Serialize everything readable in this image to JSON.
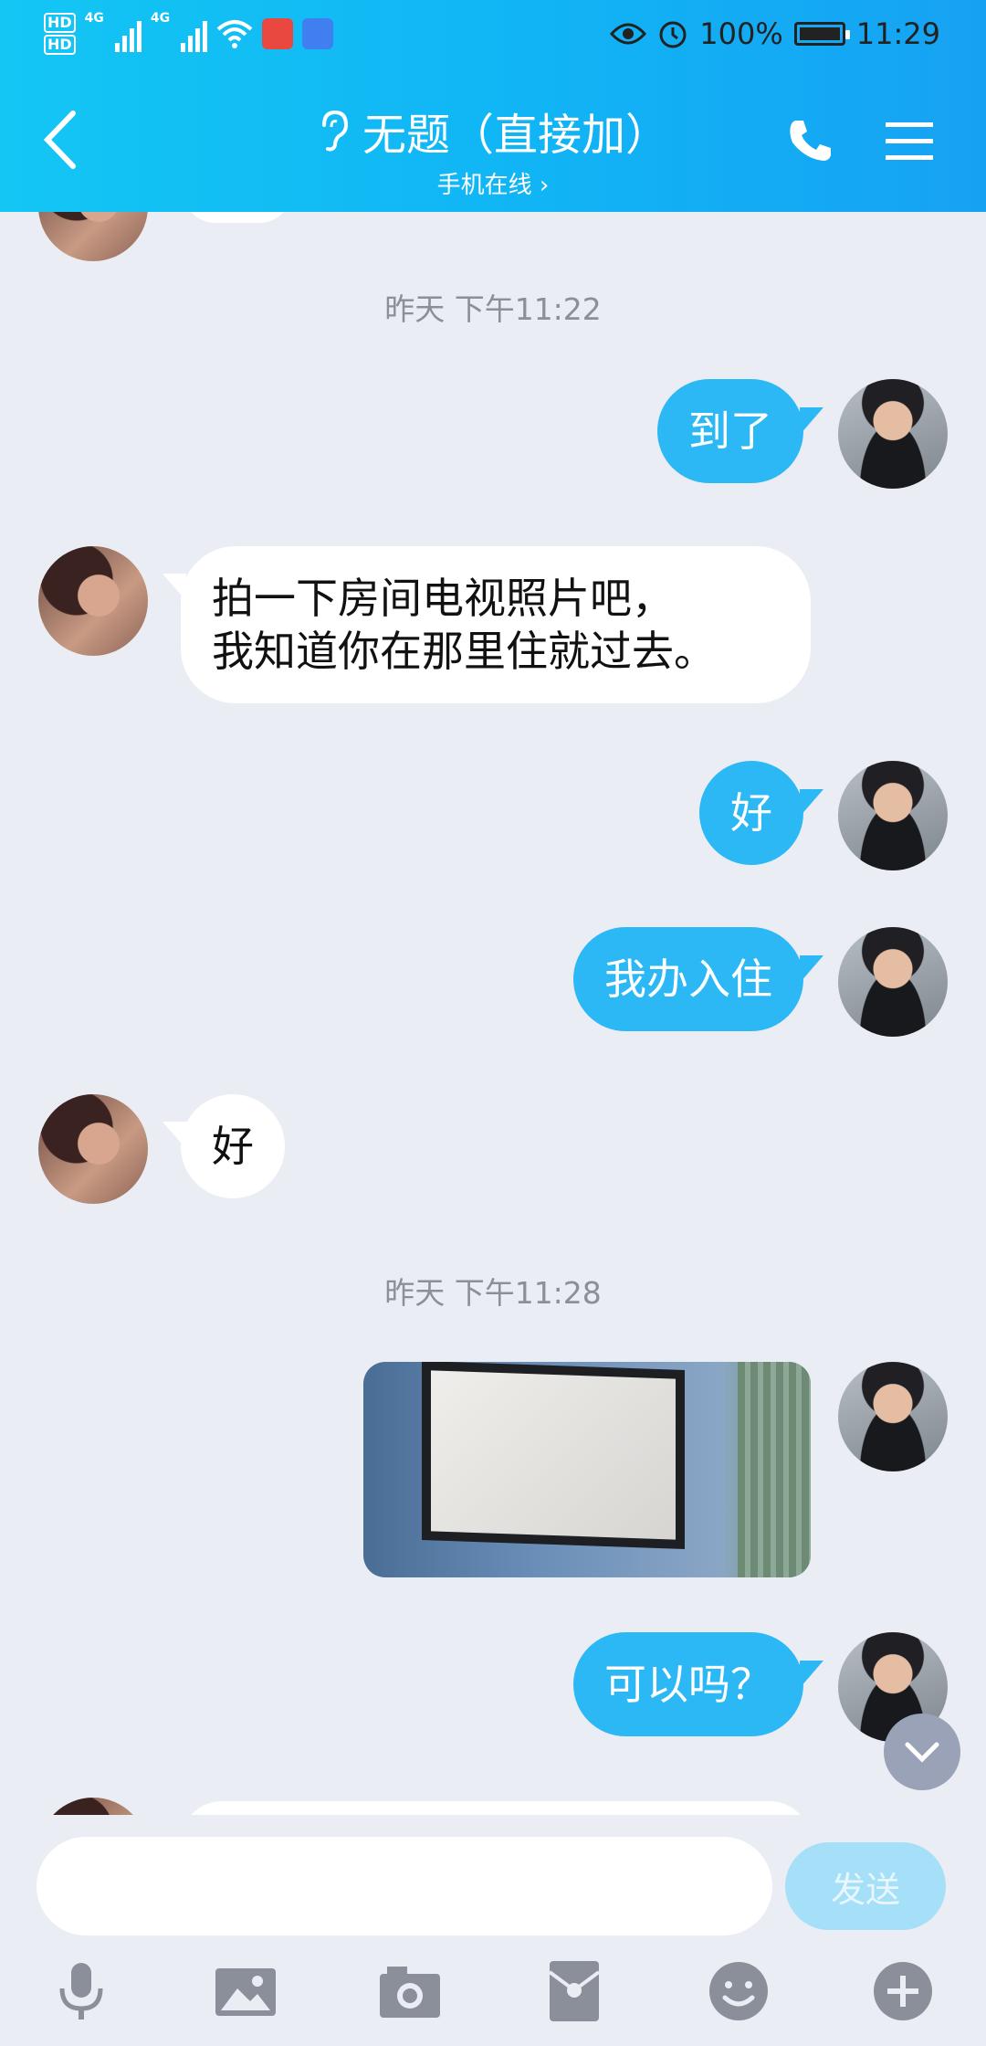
{
  "status_bar": {
    "net1": "4G",
    "net2": "4G",
    "battery": "100%",
    "time": "11:29"
  },
  "header": {
    "title": "无题（直接加）",
    "subtitle": "手机在线 ›"
  },
  "messages": [
    {
      "kind": "time",
      "text": "昨天 下午11:22"
    },
    {
      "kind": "out",
      "text": "到了"
    },
    {
      "kind": "in",
      "line1": "拍一下房间电视照片吧，",
      "line2": "我知道你在那里住就过去。"
    },
    {
      "kind": "out",
      "text": "好"
    },
    {
      "kind": "out",
      "text": "我办入住"
    },
    {
      "kind": "in",
      "text": "好"
    },
    {
      "kind": "time",
      "text": "昨天 下午11:28"
    },
    {
      "kind": "out-image"
    },
    {
      "kind": "out",
      "text": "可以吗？"
    }
  ],
  "composer": {
    "placeholder": "",
    "send_label": "发送"
  },
  "toolbar": {
    "icons": [
      "microphone-icon",
      "image-icon",
      "camera-icon",
      "red-packet-icon",
      "emoji-icon",
      "plus-icon"
    ]
  },
  "colors": {
    "header_start": "#13c6f4",
    "header_end": "#16a2f3",
    "outgoing_bubble": "#2bb8f5",
    "incoming_bubble": "#ffffff",
    "background": "#eaedf4"
  }
}
